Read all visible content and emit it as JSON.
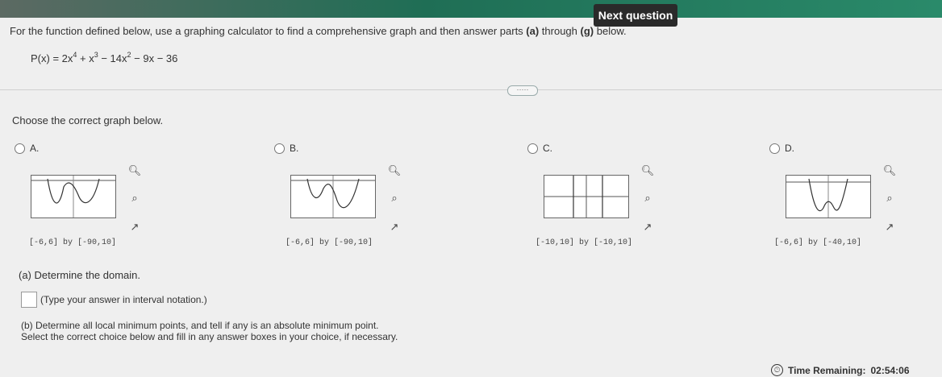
{
  "header": {
    "next_label": "Next question"
  },
  "question": {
    "intro": "For the function defined below, use a graphing calculator to find a comprehensive graph and then answer parts ",
    "part_a_ref": "(a)",
    "through": " through ",
    "part_g_ref": "(g)",
    "intro_end": " below.",
    "function_lhs": "P(x) = 2x",
    "exp4": "4",
    "plus_x": " + x",
    "exp3": "3",
    "minus_14x": " − 14x",
    "exp2": "2",
    "rest": " − 9x − 36"
  },
  "expander_label": "·····",
  "prompt": "Choose the correct graph below.",
  "choices": [
    {
      "label": "A.",
      "window": "[-6,6] by [-90,10]"
    },
    {
      "label": "B.",
      "window": "[-6,6] by [-90,10]"
    },
    {
      "label": "C.",
      "window": "[-10,10] by [-10,10]"
    },
    {
      "label": "D.",
      "window": "[-6,6] by [-40,10]"
    }
  ],
  "icons": {
    "zoom_in": "zoom-in-icon",
    "zoom_out": "zoom-out-icon",
    "expand": "open-in-new-icon",
    "clock": "clock-icon"
  },
  "part_a": {
    "title": "(a) Determine the domain.",
    "hint": "(Type your answer in interval notation.)"
  },
  "part_b": {
    "title": "(b) Determine all local minimum points, and tell if any is an absolute minimum point.",
    "sub": "Select the correct choice below and fill in any answer boxes in your choice, if necessary."
  },
  "timer": {
    "label": "Time Remaining:",
    "value": "02:54:06"
  }
}
